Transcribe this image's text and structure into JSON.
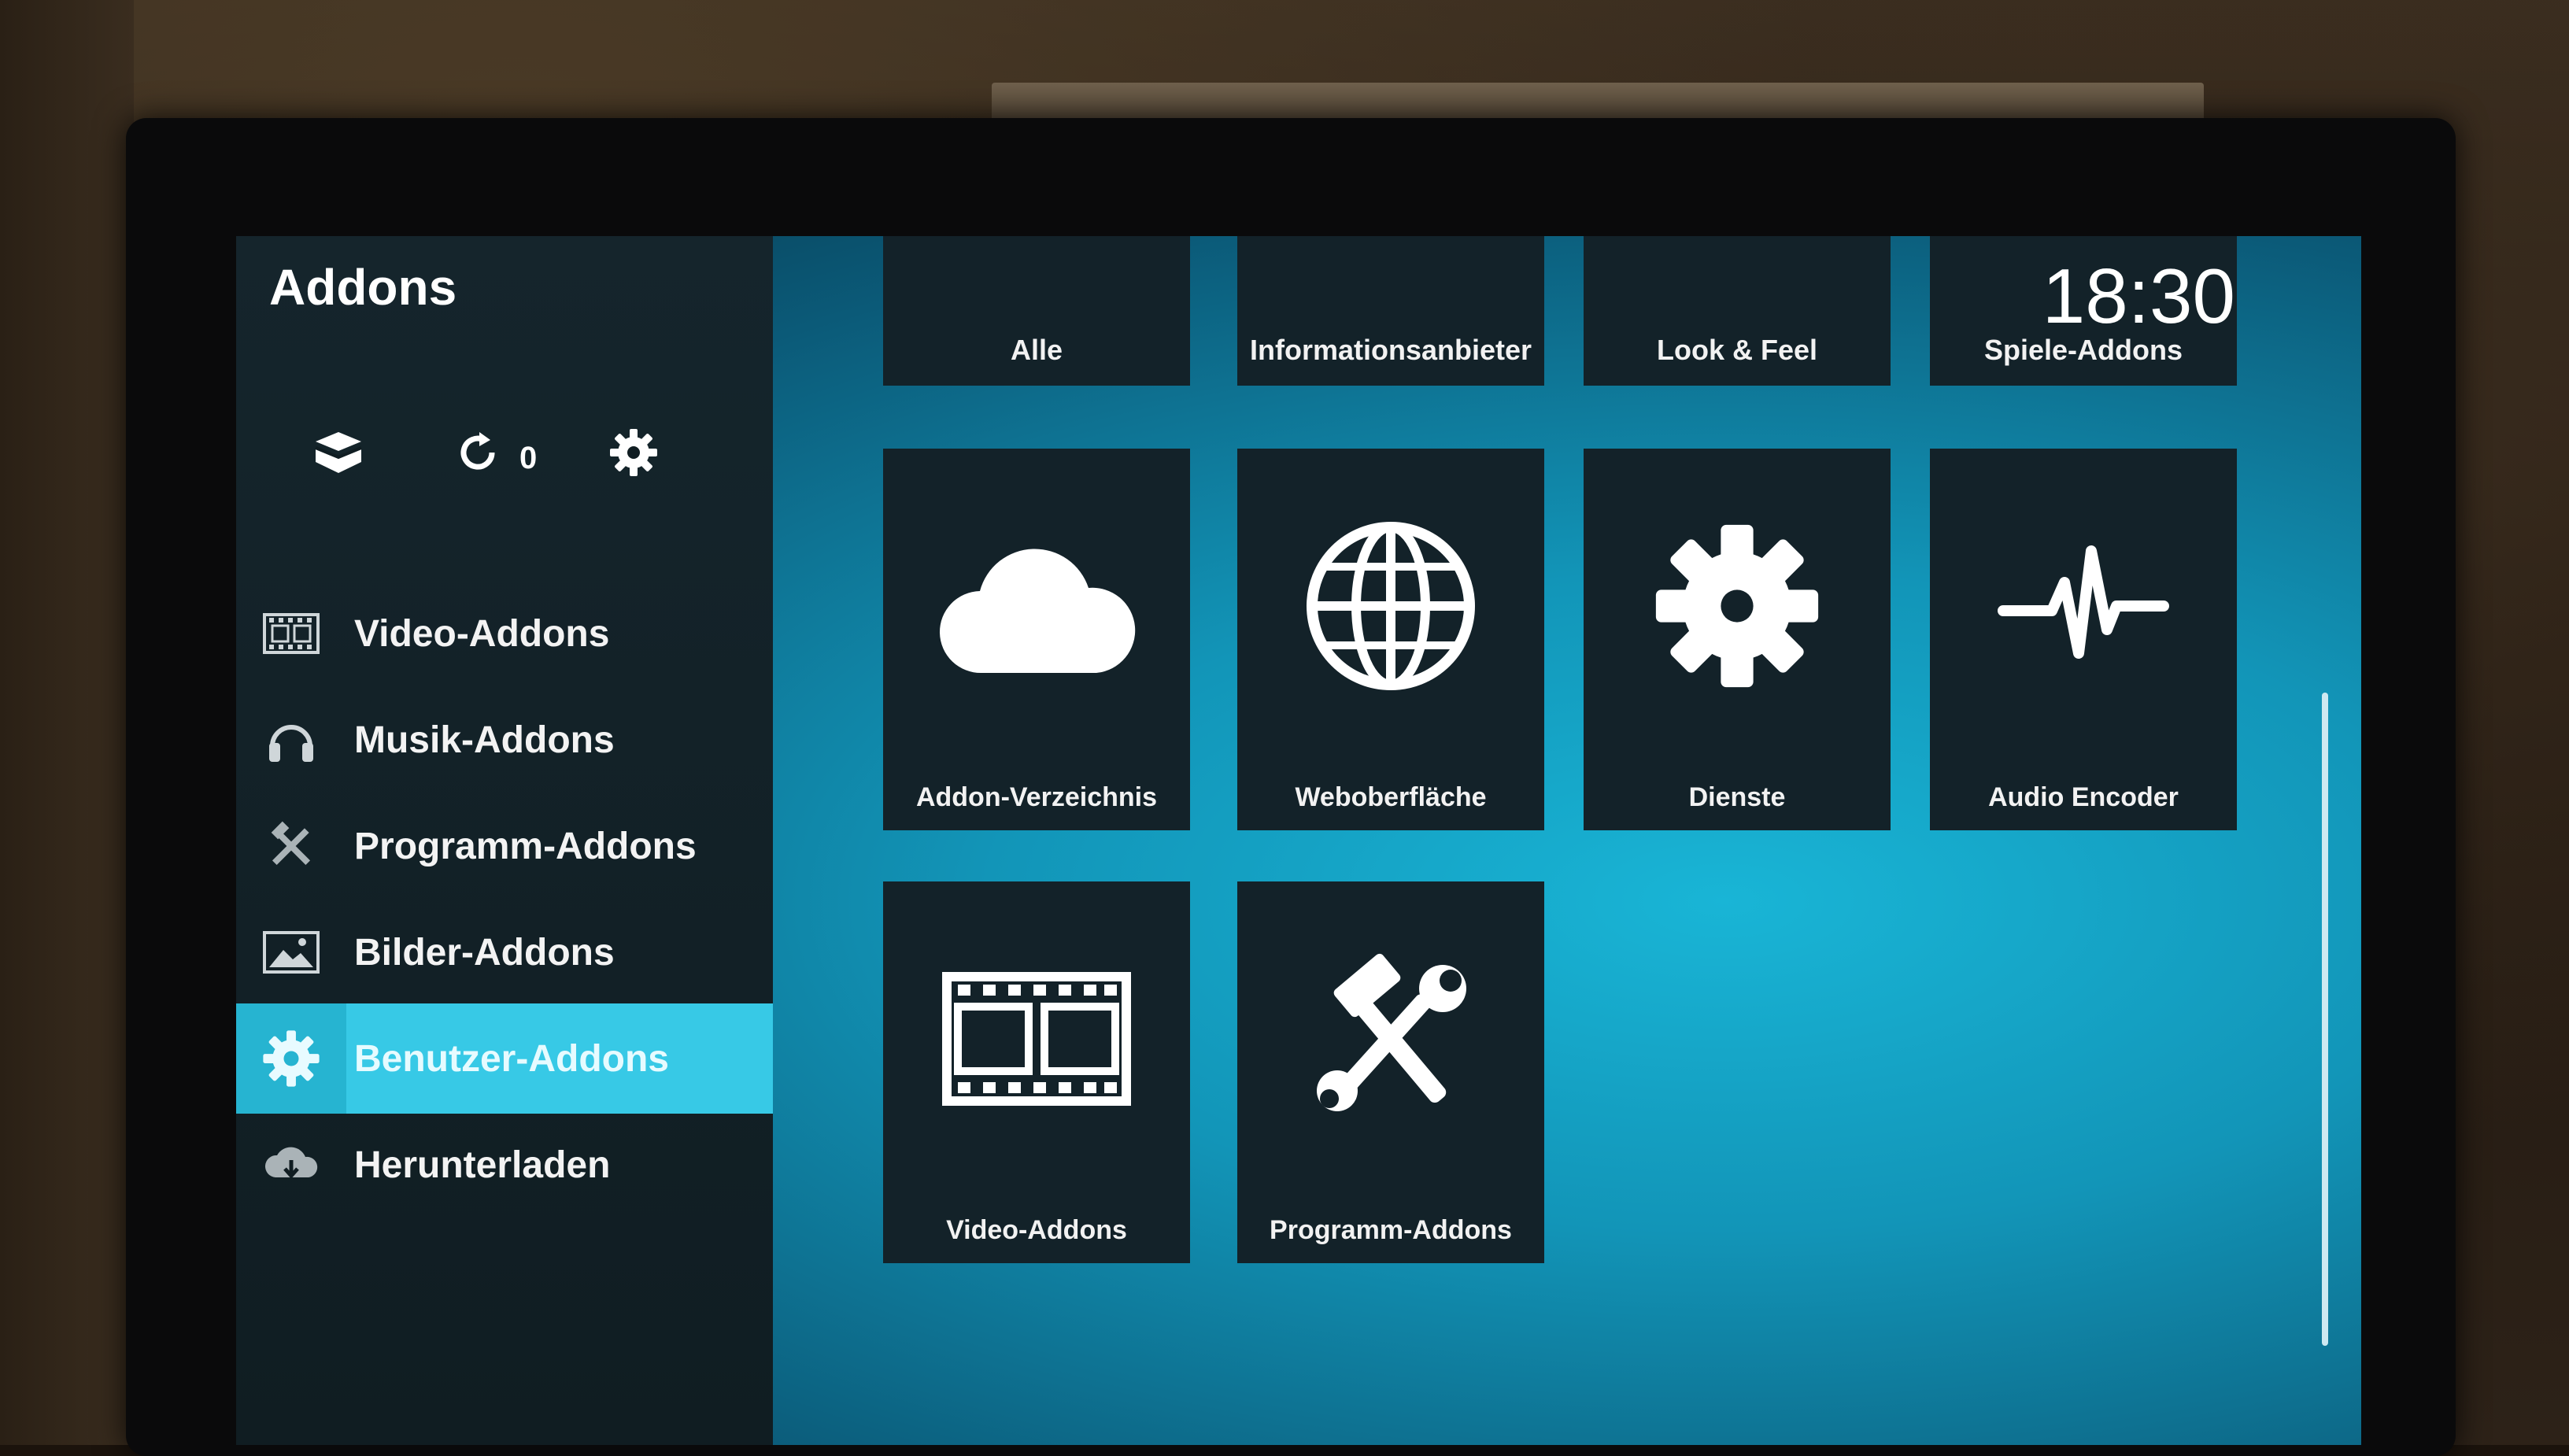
{
  "header": {
    "title": "Addons",
    "clock": "18:30"
  },
  "toolbar": {
    "installed_icon": "open-box-icon",
    "updates_icon": "refresh-icon",
    "updates_count": "0",
    "settings_icon": "gear-icon"
  },
  "sidebar": {
    "items": [
      {
        "label": "Video-Addons",
        "icon": "film-icon"
      },
      {
        "label": "Musik-Addons",
        "icon": "headphones-icon"
      },
      {
        "label": "Programm-Addons",
        "icon": "tools-icon"
      },
      {
        "label": "Bilder-Addons",
        "icon": "picture-icon"
      },
      {
        "label": "Benutzer-Addons",
        "icon": "gear-icon",
        "selected": true
      },
      {
        "label": "Herunterladen",
        "icon": "cloud-download-icon"
      }
    ]
  },
  "tabs": [
    "Alle",
    "Informationsanbieter",
    "Look & Feel",
    "Spiele-Addons"
  ],
  "tiles": [
    {
      "label": "Addon-Verzeichnis",
      "icon": "cloud-icon"
    },
    {
      "label": "Weboberfläche",
      "icon": "globe-icon"
    },
    {
      "label": "Dienste",
      "icon": "gear-icon"
    },
    {
      "label": "Audio Encoder",
      "icon": "waveform-icon"
    },
    {
      "label": "Video-Addons",
      "icon": "film-icon"
    },
    {
      "label": "Programm-Addons",
      "icon": "tools-icon"
    }
  ],
  "colors": {
    "accent": "#37c9e6",
    "sidebar_bg": "#101d22",
    "tile_bg": "#132229"
  }
}
